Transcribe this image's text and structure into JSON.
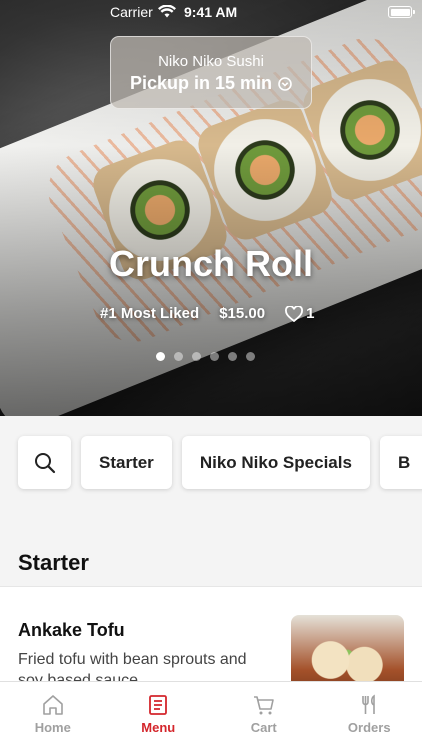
{
  "status": {
    "carrier": "Carrier",
    "time": "9:41 AM"
  },
  "store": {
    "name": "Niko Niko Sushi",
    "pickup": "Pickup in 15 min"
  },
  "featured": {
    "title": "Crunch Roll",
    "rank": "#1 Most Liked",
    "price": "$15.00",
    "likes": "1",
    "page_count": 6,
    "active_page": 1
  },
  "categories": {
    "items": [
      "Starter",
      "Niko Niko Specials",
      "B"
    ]
  },
  "section": {
    "title": "Starter"
  },
  "menu_item": {
    "name": "Ankake Tofu",
    "description": "Fried tofu with bean sprouts and soy based sauce"
  },
  "tabs": [
    {
      "label": "Home",
      "icon": "home-icon"
    },
    {
      "label": "Menu",
      "icon": "menu-icon",
      "active": true
    },
    {
      "label": "Cart",
      "icon": "cart-icon"
    },
    {
      "label": "Orders",
      "icon": "utensils-icon"
    }
  ],
  "colors": {
    "accent": "#d4262c",
    "inactive": "#a0a0a0"
  }
}
